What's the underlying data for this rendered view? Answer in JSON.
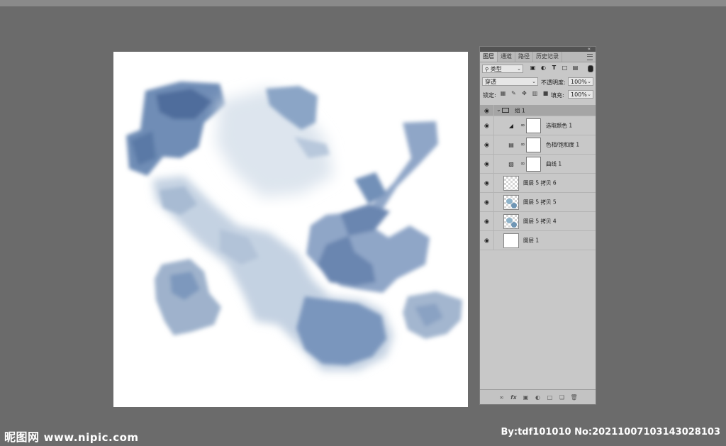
{
  "panel": {
    "tabs": [
      "图层",
      "通道",
      "路径",
      "历史记录"
    ],
    "active_tab": 0,
    "collapse_glyph": "«",
    "filter": {
      "value": "类型",
      "icon": "search-icon"
    },
    "filter_icons": [
      "image-filter-icon",
      "adjustment-filter-icon",
      "text-filter-icon",
      "shape-filter-icon",
      "smart-object-filter-icon"
    ],
    "blend_mode": "穿透",
    "opacity_label": "不透明度:",
    "opacity_value": "100%",
    "lock_label": "锁定:",
    "fill_label": "填充:",
    "fill_value": "100%"
  },
  "layers": [
    {
      "type": "group",
      "name": "组 1",
      "expanded": true
    },
    {
      "type": "adjustment",
      "name": "选取颜色 1",
      "icon": "selective-color-icon"
    },
    {
      "type": "adjustment",
      "name": "色相/饱和度 1",
      "icon": "hue-saturation-icon"
    },
    {
      "type": "adjustment",
      "name": "曲线 1",
      "icon": "curves-icon"
    },
    {
      "type": "pixel",
      "name": "图层 5 拷贝 6",
      "thumb": "transparent"
    },
    {
      "type": "pixel",
      "name": "图层 5 拷贝 5",
      "thumb": "paint"
    },
    {
      "type": "pixel",
      "name": "图层 5 拷贝 4",
      "thumb": "paint"
    },
    {
      "type": "pixel",
      "name": "图层 1",
      "thumb": "white"
    }
  ],
  "footer_icons": [
    "link-layers-icon",
    "fx-icon",
    "add-mask-icon",
    "new-adjustment-icon",
    "new-group-icon",
    "new-layer-icon",
    "delete-layer-icon"
  ],
  "watermark": {
    "site_name": "昵图网",
    "site_url": "www.nipic.com",
    "credit": "By:tdf101010 No:20211007103143028103"
  },
  "colors": {
    "workspace": "#6b6b6b",
    "panel": "#c8c8c8",
    "ink": "#5f7ea8"
  }
}
